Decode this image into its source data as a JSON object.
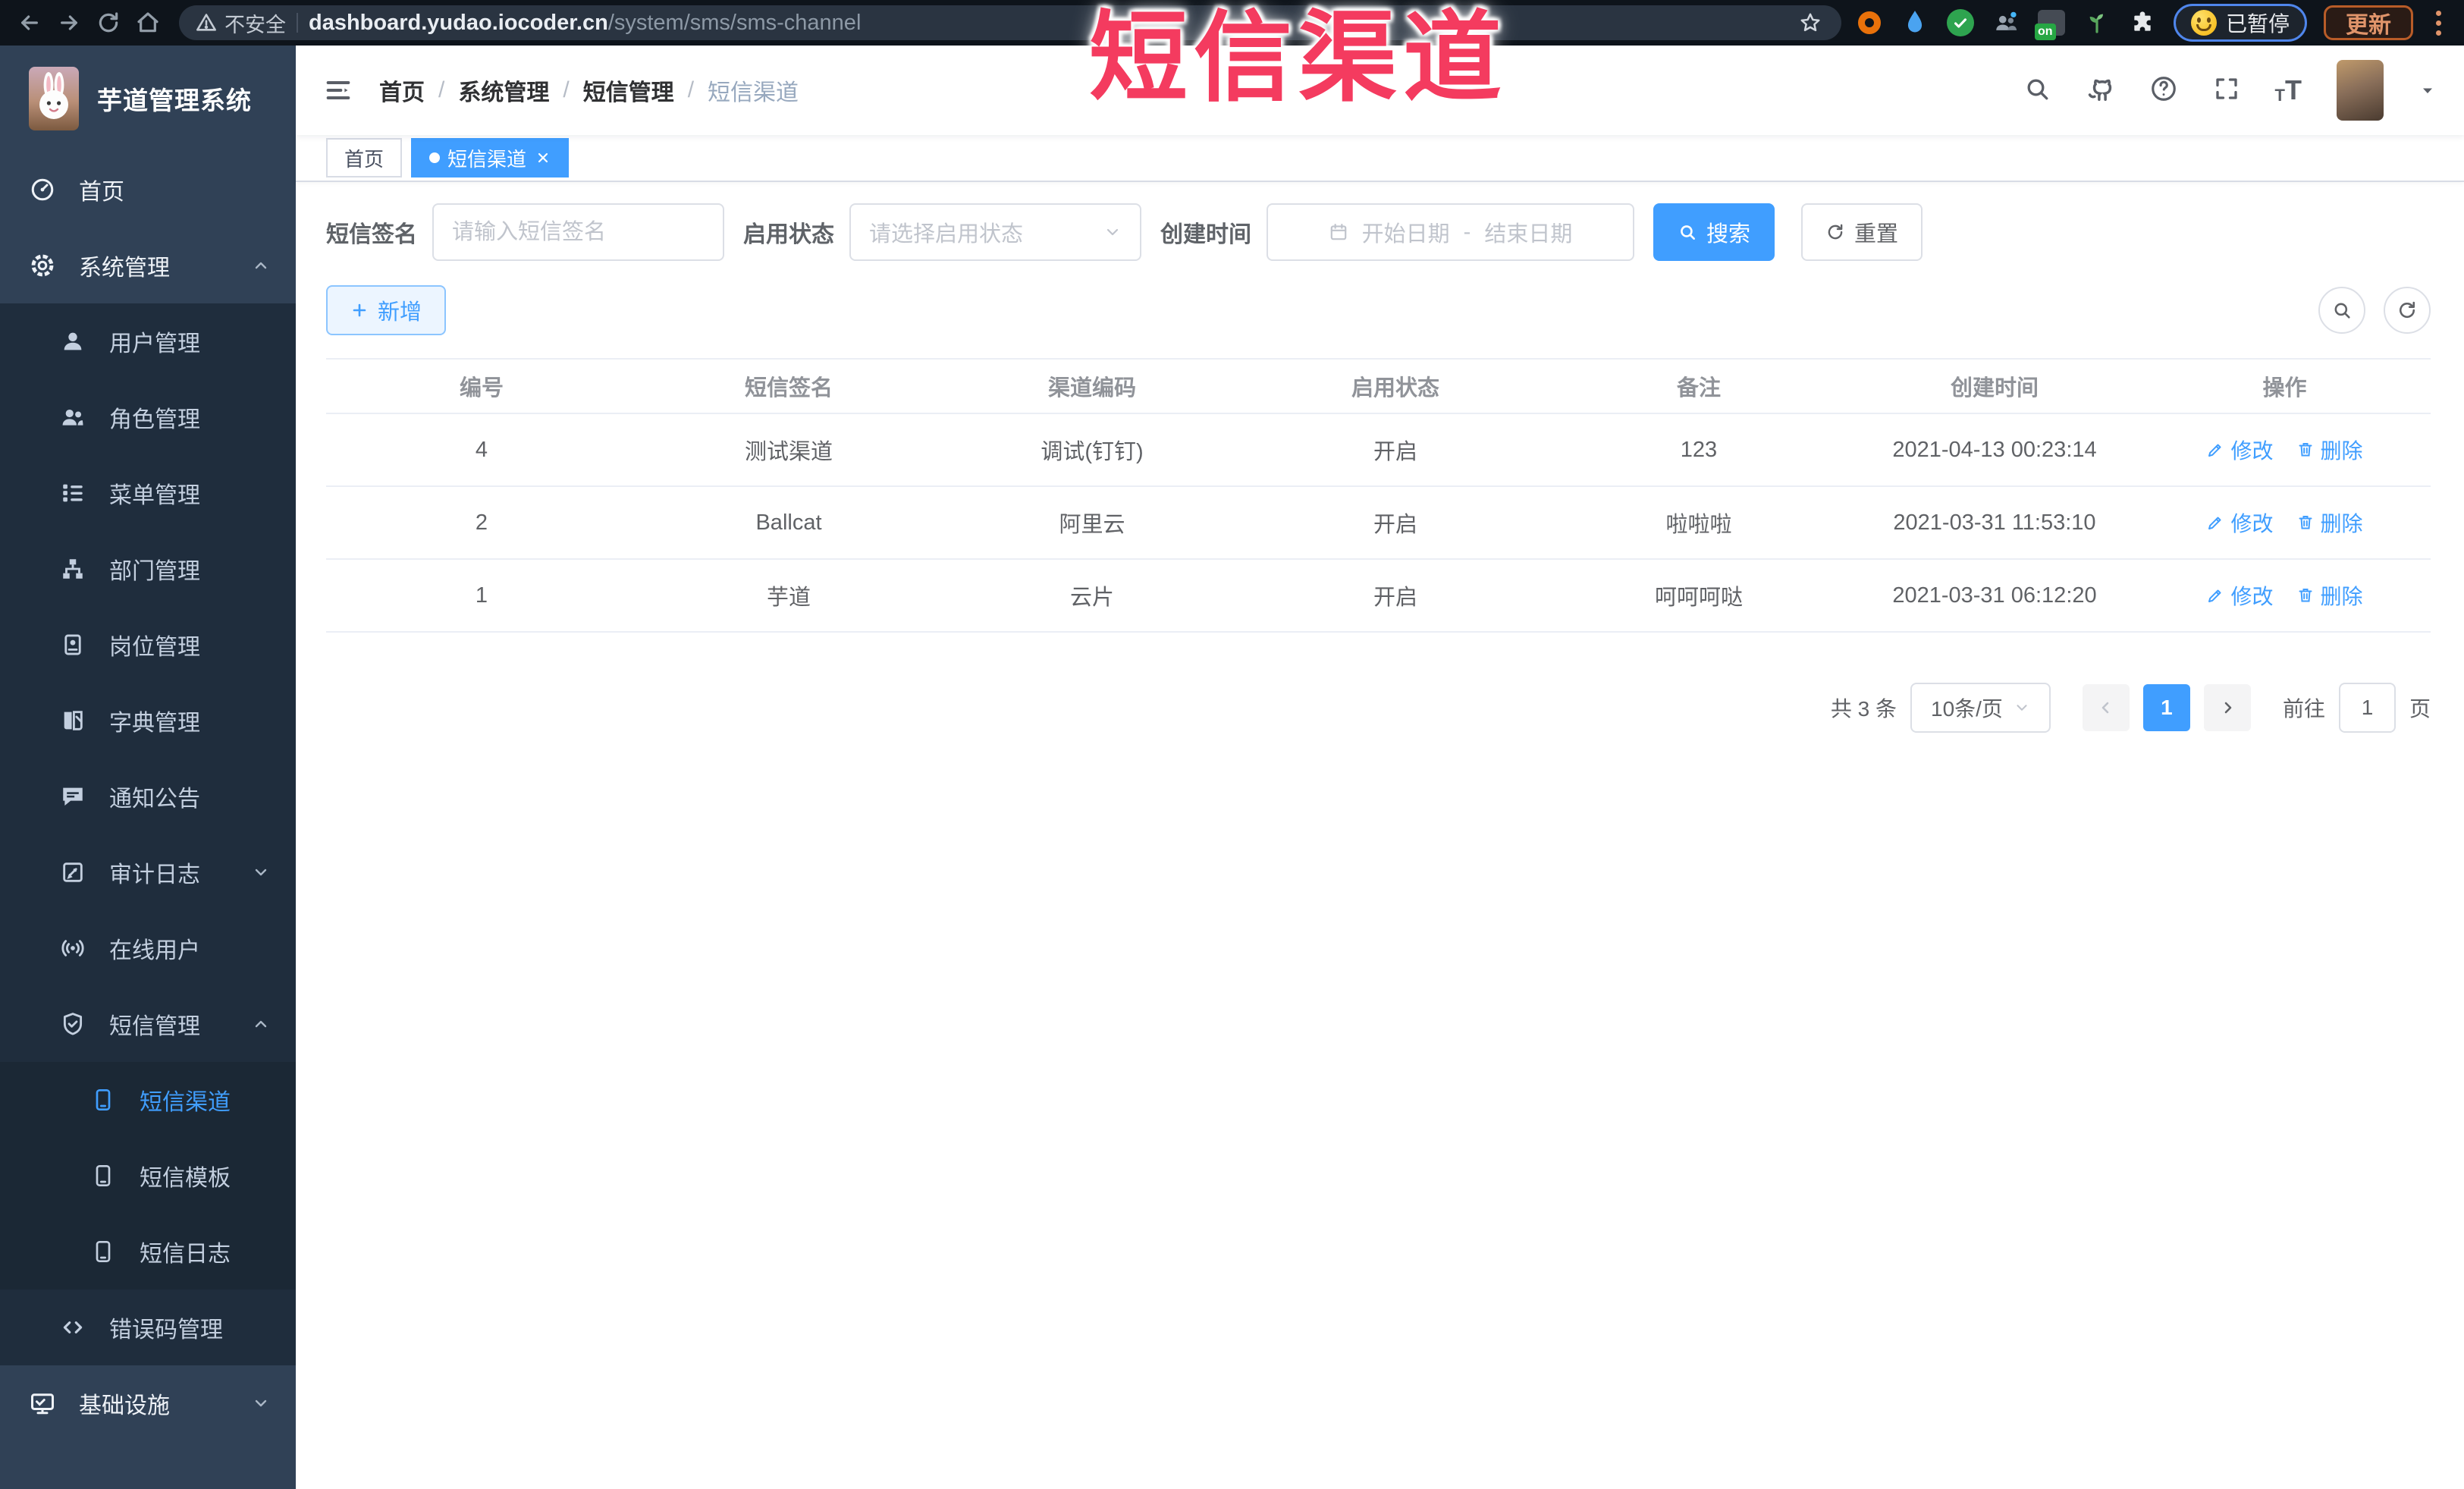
{
  "browser": {
    "security_label": "不安全",
    "url_domain": "dashboard.yudao.iocoder.cn",
    "url_path": "/system/sms/sms-channel",
    "extension_on_badge": "on",
    "paused_label": "已暂停",
    "update_label": "更新"
  },
  "overlay": {
    "title": "短信渠道"
  },
  "sidebar": {
    "title": "芋道管理系统",
    "items": [
      {
        "label": "首页"
      },
      {
        "label": "系统管理"
      },
      {
        "label": "用户管理"
      },
      {
        "label": "角色管理"
      },
      {
        "label": "菜单管理"
      },
      {
        "label": "部门管理"
      },
      {
        "label": "岗位管理"
      },
      {
        "label": "字典管理"
      },
      {
        "label": "通知公告"
      },
      {
        "label": "审计日志"
      },
      {
        "label": "在线用户"
      },
      {
        "label": "短信管理"
      },
      {
        "label": "短信渠道"
      },
      {
        "label": "短信模板"
      },
      {
        "label": "短信日志"
      },
      {
        "label": "错误码管理"
      },
      {
        "label": "基础设施"
      }
    ]
  },
  "header": {
    "separator": "/",
    "breadcrumb": [
      {
        "label": "首页"
      },
      {
        "label": "系统管理"
      },
      {
        "label": "短信管理"
      },
      {
        "label": "短信渠道"
      }
    ]
  },
  "tabs": [
    {
      "label": "首页"
    },
    {
      "label": "短信渠道"
    }
  ],
  "filter": {
    "sign_label": "短信签名",
    "sign_placeholder": "请输入短信签名",
    "status_label": "启用状态",
    "status_placeholder": "请选择启用状态",
    "time_label": "创建时间",
    "start_placeholder": "开始日期",
    "range_separator": "-",
    "end_placeholder": "结束日期",
    "search_label": "搜索",
    "reset_label": "重置"
  },
  "toolbar": {
    "add_label": "新增"
  },
  "table": {
    "columns": [
      "编号",
      "短信签名",
      "渠道编码",
      "启用状态",
      "备注",
      "创建时间",
      "操作"
    ],
    "edit_label": "修改",
    "delete_label": "删除",
    "rows": [
      {
        "id": "4",
        "signature": "测试渠道",
        "code": "调试(钉钉)",
        "status": "开启",
        "remark": "123",
        "created": "2021-04-13 00:23:14"
      },
      {
        "id": "2",
        "signature": "Ballcat",
        "code": "阿里云",
        "status": "开启",
        "remark": "啦啦啦",
        "created": "2021-03-31 11:53:10"
      },
      {
        "id": "1",
        "signature": "芋道",
        "code": "云片",
        "status": "开启",
        "remark": "呵呵呵哒",
        "created": "2021-03-31 06:12:20"
      }
    ]
  },
  "pagination": {
    "total": "共 3 条",
    "page_size": "10条/页",
    "current": "1",
    "goto_label": "前往",
    "goto_value": "1",
    "unit_label": "页"
  },
  "colors": {
    "accent": "#409eff",
    "overlay_red": "#f43b5f",
    "sidebar_bg": "#304156",
    "submenu_bg": "#1f2d3d"
  }
}
